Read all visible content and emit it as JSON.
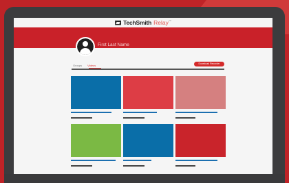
{
  "brand": {
    "name": "TechSmith",
    "product": "Relay",
    "trademark": "™"
  },
  "profile": {
    "name": "First Last Name"
  },
  "tabs": [
    {
      "label": "Groups"
    },
    {
      "label": "Videos"
    }
  ],
  "active_tab": "Videos",
  "download_button": "Download Recorder",
  "colors": {
    "background": "#bf2327",
    "device": "#3c3c3e",
    "banner": "#c92129",
    "accent": "#d42a2a",
    "link_bar": "#1b6fb0"
  },
  "videos": [
    {
      "color": "#0a6ea8"
    },
    {
      "color": "#dd3d45"
    },
    {
      "color": "#d58080"
    },
    {
      "color": "#7bb944"
    },
    {
      "color": "#0a6ea8"
    },
    {
      "color": "#c9242b"
    }
  ]
}
